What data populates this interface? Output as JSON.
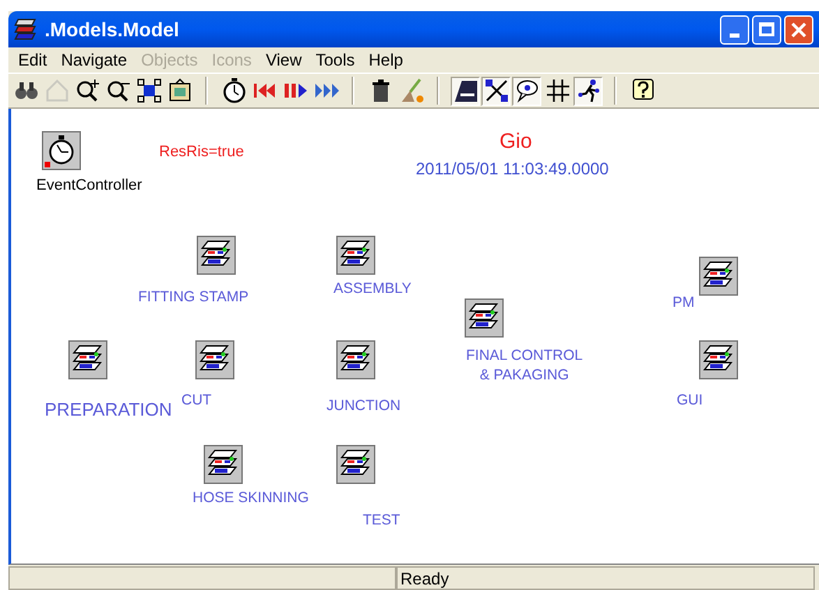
{
  "window": {
    "title": ".Models.Model"
  },
  "menu": [
    {
      "label": "Edit",
      "disabled": false
    },
    {
      "label": "Navigate",
      "disabled": false
    },
    {
      "label": "Objects",
      "disabled": true
    },
    {
      "label": "Icons",
      "disabled": true
    },
    {
      "label": "View",
      "disabled": false
    },
    {
      "label": "Tools",
      "disabled": false
    },
    {
      "label": "Help",
      "disabled": false
    }
  ],
  "toolbar": {
    "groups": [
      [
        {
          "disabled": false,
          "pressed": false
        },
        {
          "disabled": true,
          "pressed": false
        },
        {
          "disabled": false,
          "pressed": false
        },
        {
          "disabled": false,
          "pressed": false
        },
        {
          "disabled": false,
          "pressed": false
        },
        {
          "disabled": false,
          "pressed": false
        }
      ],
      [
        {
          "disabled": false,
          "pressed": false
        },
        {
          "disabled": false,
          "pressed": false
        },
        {
          "disabled": false,
          "pressed": false
        },
        {
          "disabled": false,
          "pressed": false
        }
      ],
      [
        {
          "disabled": false,
          "pressed": false
        },
        {
          "disabled": false,
          "pressed": false
        }
      ],
      [
        {
          "disabled": false,
          "pressed": true
        },
        {
          "disabled": false,
          "pressed": true
        },
        {
          "disabled": false,
          "pressed": true
        },
        {
          "disabled": false,
          "pressed": false
        },
        {
          "disabled": false,
          "pressed": true
        }
      ],
      [
        {
          "disabled": false,
          "pressed": false
        }
      ]
    ]
  },
  "canvas": {
    "texts": [
      {
        "kind": "status",
        "text": "ResRis=true"
      },
      {
        "kind": "name",
        "text": "Gio"
      },
      {
        "kind": "time",
        "text": "2011/05/01 11:03:49.0000"
      }
    ],
    "nodes": [
      {
        "kind": "controller",
        "label": "EventController"
      },
      {
        "kind": "model",
        "label": "FITTING STAMP"
      },
      {
        "kind": "model",
        "label": "ASSEMBLY"
      },
      {
        "kind": "model",
        "label": "FINAL CONTROL\n& PAKAGING"
      },
      {
        "kind": "model",
        "label": "PM"
      },
      {
        "kind": "model",
        "label": "PREPARATION"
      },
      {
        "kind": "model",
        "label": "CUT"
      },
      {
        "kind": "model",
        "label": "JUNCTION"
      },
      {
        "kind": "model",
        "label": "GUI"
      },
      {
        "kind": "model",
        "label": "HOSE SKINNING"
      },
      {
        "kind": "model",
        "label": "TEST"
      }
    ]
  },
  "status_bar": {
    "text": "Ready"
  }
}
